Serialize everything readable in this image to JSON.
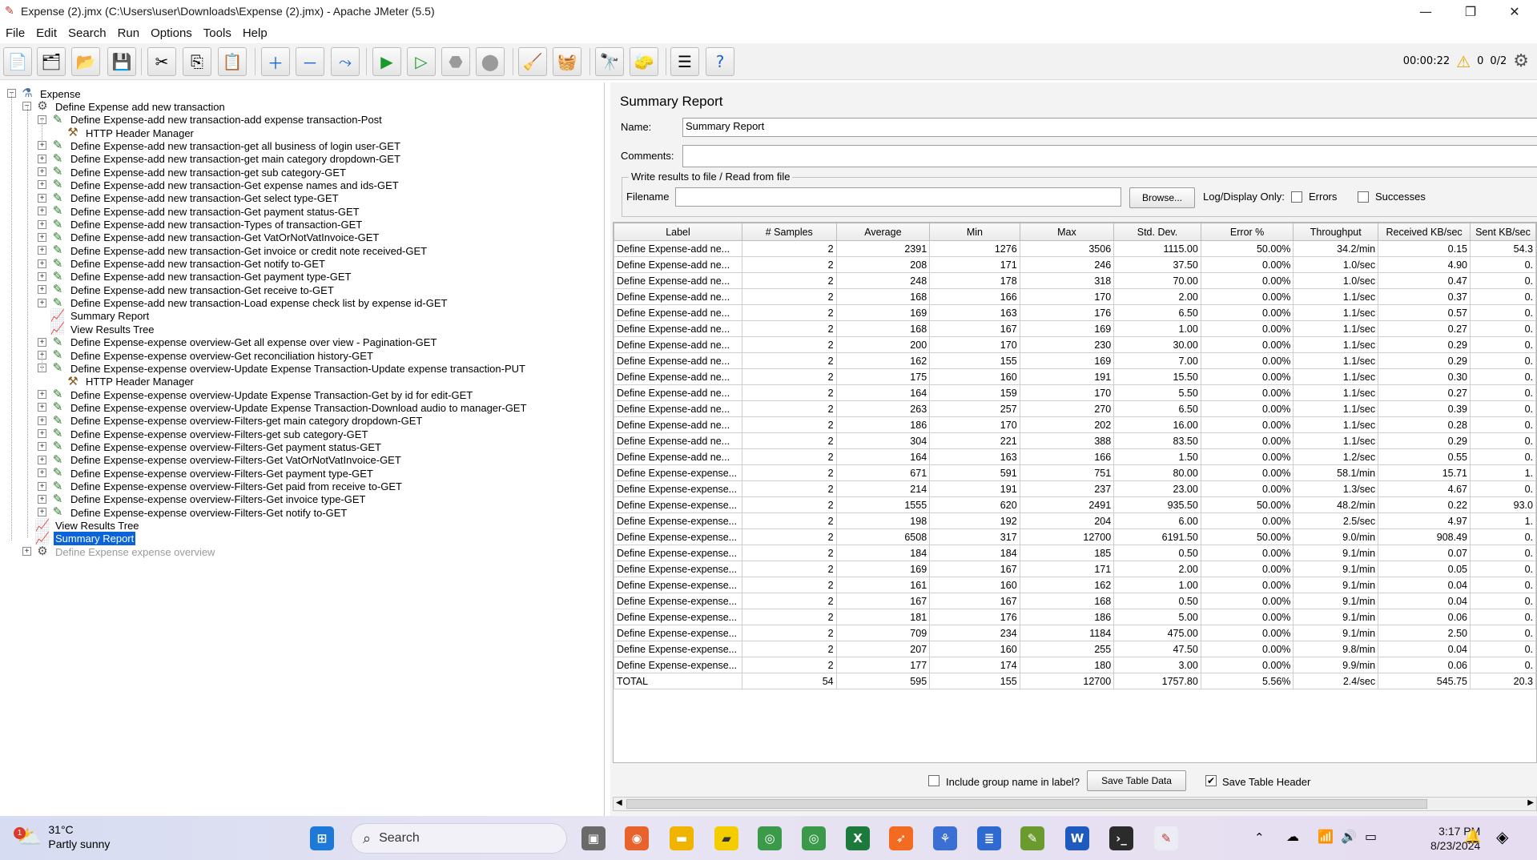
{
  "window": {
    "title": "Expense (2).jmx (C:\\Users\\user\\Downloads\\Expense (2).jmx) - Apache JMeter (5.5)",
    "minimize": "—",
    "maximize": "❐",
    "close": "✕"
  },
  "menu": [
    "File",
    "Edit",
    "Search",
    "Run",
    "Options",
    "Tools",
    "Help"
  ],
  "toolbar_status": {
    "elapsed": "00:00:22",
    "warnings": "0",
    "threads": "0/2"
  },
  "tree": [
    {
      "label": "Expense",
      "depth": 0,
      "exp": "−",
      "icon": "flask-icon"
    },
    {
      "label": "Define Expense add new transaction",
      "depth": 1,
      "exp": "−",
      "icon": "thread-group-icon"
    },
    {
      "label": "Define Expense-add new transaction-add expense transaction-Post",
      "depth": 2,
      "exp": "−",
      "icon": "sampler-icon"
    },
    {
      "label": "HTTP Header Manager",
      "depth": 3,
      "exp": "",
      "icon": "config-icon"
    },
    {
      "label": "Define Expense-add new transaction-get all business of login user-GET",
      "depth": 2,
      "exp": "+",
      "icon": "sampler-icon"
    },
    {
      "label": "Define Expense-add new transaction-get main category dropdown-GET",
      "depth": 2,
      "exp": "+",
      "icon": "sampler-icon"
    },
    {
      "label": "Define Expense-add new transaction-get sub category-GET",
      "depth": 2,
      "exp": "+",
      "icon": "sampler-icon"
    },
    {
      "label": "Define Expense-add new transaction-Get expense names and ids-GET",
      "depth": 2,
      "exp": "+",
      "icon": "sampler-icon"
    },
    {
      "label": "Define Expense-add new transaction-Get select type-GET",
      "depth": 2,
      "exp": "+",
      "icon": "sampler-icon"
    },
    {
      "label": "Define Expense-add new transaction-Get payment status-GET",
      "depth": 2,
      "exp": "+",
      "icon": "sampler-icon"
    },
    {
      "label": "Define Expense-add new transaction-Types of transaction-GET",
      "depth": 2,
      "exp": "+",
      "icon": "sampler-icon"
    },
    {
      "label": "Define Expense-add new transaction-Get VatOrNotVatInvoice-GET",
      "depth": 2,
      "exp": "+",
      "icon": "sampler-icon"
    },
    {
      "label": "Define Expense-add new transaction-Get invoice or credit note received-GET",
      "depth": 2,
      "exp": "+",
      "icon": "sampler-icon"
    },
    {
      "label": "Define Expense-add new transaction-Get notify to-GET",
      "depth": 2,
      "exp": "+",
      "icon": "sampler-icon"
    },
    {
      "label": "Define Expense-add new transaction-Get payment type-GET",
      "depth": 2,
      "exp": "+",
      "icon": "sampler-icon"
    },
    {
      "label": "Define Expense-add new transaction-Get receive to-GET",
      "depth": 2,
      "exp": "+",
      "icon": "sampler-icon"
    },
    {
      "label": "Define Expense-add new transaction-Load expense check list by expense id-GET",
      "depth": 2,
      "exp": "+",
      "icon": "sampler-icon"
    },
    {
      "label": "Summary Report",
      "depth": 2,
      "exp": "",
      "icon": "listener-icon"
    },
    {
      "label": "View Results Tree",
      "depth": 2,
      "exp": "",
      "icon": "listener-icon"
    },
    {
      "label": "Define Expense-expense overview-Get all expense over view - Pagination-GET",
      "depth": 2,
      "exp": "+",
      "icon": "sampler-icon"
    },
    {
      "label": "Define Expense-expense overview-Get reconciliation history-GET",
      "depth": 2,
      "exp": "+",
      "icon": "sampler-icon"
    },
    {
      "label": "Define Expense-expense overview-Update Expense Transaction-Update expense transaction-PUT",
      "depth": 2,
      "exp": "−",
      "icon": "sampler-icon"
    },
    {
      "label": "HTTP Header Manager",
      "depth": 3,
      "exp": "",
      "icon": "config-icon"
    },
    {
      "label": "Define Expense-expense overview-Update Expense Transaction-Get by id for edit-GET",
      "depth": 2,
      "exp": "+",
      "icon": "sampler-icon"
    },
    {
      "label": "Define Expense-expense overview-Update Expense Transaction-Download audio to manager-GET",
      "depth": 2,
      "exp": "+",
      "icon": "sampler-icon"
    },
    {
      "label": "Define Expense-expense overview-Filters-get main category dropdown-GET",
      "depth": 2,
      "exp": "+",
      "icon": "sampler-icon"
    },
    {
      "label": "Define Expense-expense overview-Filters-get sub category-GET",
      "depth": 2,
      "exp": "+",
      "icon": "sampler-icon"
    },
    {
      "label": "Define Expense-expense overview-Filters-Get payment status-GET",
      "depth": 2,
      "exp": "+",
      "icon": "sampler-icon"
    },
    {
      "label": "Define Expense-expense overview-Filters-Get VatOrNotVatInvoice-GET",
      "depth": 2,
      "exp": "+",
      "icon": "sampler-icon"
    },
    {
      "label": "Define Expense-expense overview-Filters-Get payment type-GET",
      "depth": 2,
      "exp": "+",
      "icon": "sampler-icon"
    },
    {
      "label": "Define Expense-expense overview-Filters-Get paid from receive to-GET",
      "depth": 2,
      "exp": "+",
      "icon": "sampler-icon"
    },
    {
      "label": "Define Expense-expense overview-Filters-Get invoice type-GET",
      "depth": 2,
      "exp": "+",
      "icon": "sampler-icon"
    },
    {
      "label": "Define Expense-expense overview-Filters-Get notify to-GET",
      "depth": 2,
      "exp": "+",
      "icon": "sampler-icon"
    },
    {
      "label": "View Results Tree",
      "depth": 1,
      "exp": "",
      "icon": "listener-icon"
    },
    {
      "label": "Summary Report",
      "depth": 1,
      "exp": "",
      "icon": "listener-icon",
      "selected": true
    },
    {
      "label": "Define Expense expense overview",
      "depth": 1,
      "exp": "+",
      "icon": "thread-group-icon",
      "disabled": true
    }
  ],
  "report": {
    "heading": "Summary Report",
    "name_label": "Name:",
    "name_value": "Summary Report",
    "comments_label": "Comments:",
    "comments_value": "",
    "write_legend": "Write results to file / Read from file",
    "filename_label": "Filename",
    "filename_value": "",
    "browse": "Browse...",
    "log_display": "Log/Display Only:",
    "errors": "Errors",
    "successes": "Successes",
    "include_group": "Include group name in label?",
    "save_table_data": "Save Table Data",
    "save_table_header": "Save Table Header",
    "include_group_checked": false,
    "save_header_checked": true
  },
  "table": {
    "columns": [
      "Label",
      "# Samples",
      "Average",
      "Min",
      "Max",
      "Std. Dev.",
      "Error %",
      "Throughput",
      "Received KB/sec",
      "Sent KB/sec"
    ],
    "rows": [
      [
        "Define Expense-add ne...",
        "2",
        "2391",
        "1276",
        "3506",
        "1115.00",
        "50.00%",
        "34.2/min",
        "0.15",
        "54.3"
      ],
      [
        "Define Expense-add ne...",
        "2",
        "208",
        "171",
        "246",
        "37.50",
        "0.00%",
        "1.0/sec",
        "4.90",
        "0."
      ],
      [
        "Define Expense-add ne...",
        "2",
        "248",
        "178",
        "318",
        "70.00",
        "0.00%",
        "1.0/sec",
        "0.47",
        "0."
      ],
      [
        "Define Expense-add ne...",
        "2",
        "168",
        "166",
        "170",
        "2.00",
        "0.00%",
        "1.1/sec",
        "0.37",
        "0."
      ],
      [
        "Define Expense-add ne...",
        "2",
        "169",
        "163",
        "176",
        "6.50",
        "0.00%",
        "1.1/sec",
        "0.57",
        "0."
      ],
      [
        "Define Expense-add ne...",
        "2",
        "168",
        "167",
        "169",
        "1.00",
        "0.00%",
        "1.1/sec",
        "0.27",
        "0."
      ],
      [
        "Define Expense-add ne...",
        "2",
        "200",
        "170",
        "230",
        "30.00",
        "0.00%",
        "1.1/sec",
        "0.29",
        "0."
      ],
      [
        "Define Expense-add ne...",
        "2",
        "162",
        "155",
        "169",
        "7.00",
        "0.00%",
        "1.1/sec",
        "0.29",
        "0."
      ],
      [
        "Define Expense-add ne...",
        "2",
        "175",
        "160",
        "191",
        "15.50",
        "0.00%",
        "1.1/sec",
        "0.30",
        "0."
      ],
      [
        "Define Expense-add ne...",
        "2",
        "164",
        "159",
        "170",
        "5.50",
        "0.00%",
        "1.1/sec",
        "0.27",
        "0."
      ],
      [
        "Define Expense-add ne...",
        "2",
        "263",
        "257",
        "270",
        "6.50",
        "0.00%",
        "1.1/sec",
        "0.39",
        "0."
      ],
      [
        "Define Expense-add ne...",
        "2",
        "186",
        "170",
        "202",
        "16.00",
        "0.00%",
        "1.1/sec",
        "0.28",
        "0."
      ],
      [
        "Define Expense-add ne...",
        "2",
        "304",
        "221",
        "388",
        "83.50",
        "0.00%",
        "1.1/sec",
        "0.29",
        "0."
      ],
      [
        "Define Expense-add ne...",
        "2",
        "164",
        "163",
        "166",
        "1.50",
        "0.00%",
        "1.2/sec",
        "0.55",
        "0."
      ],
      [
        "Define Expense-expense...",
        "2",
        "671",
        "591",
        "751",
        "80.00",
        "0.00%",
        "58.1/min",
        "15.71",
        "1."
      ],
      [
        "Define Expense-expense...",
        "2",
        "214",
        "191",
        "237",
        "23.00",
        "0.00%",
        "1.3/sec",
        "4.67",
        "0."
      ],
      [
        "Define Expense-expense...",
        "2",
        "1555",
        "620",
        "2491",
        "935.50",
        "50.00%",
        "48.2/min",
        "0.22",
        "93.0"
      ],
      [
        "Define Expense-expense...",
        "2",
        "198",
        "192",
        "204",
        "6.00",
        "0.00%",
        "2.5/sec",
        "4.97",
        "1."
      ],
      [
        "Define Expense-expense...",
        "2",
        "6508",
        "317",
        "12700",
        "6191.50",
        "50.00%",
        "9.0/min",
        "908.49",
        "0."
      ],
      [
        "Define Expense-expense...",
        "2",
        "184",
        "184",
        "185",
        "0.50",
        "0.00%",
        "9.1/min",
        "0.07",
        "0."
      ],
      [
        "Define Expense-expense...",
        "2",
        "169",
        "167",
        "171",
        "2.00",
        "0.00%",
        "9.1/min",
        "0.05",
        "0."
      ],
      [
        "Define Expense-expense...",
        "2",
        "161",
        "160",
        "162",
        "1.00",
        "0.00%",
        "9.1/min",
        "0.04",
        "0."
      ],
      [
        "Define Expense-expense...",
        "2",
        "167",
        "167",
        "168",
        "0.50",
        "0.00%",
        "9.1/min",
        "0.04",
        "0."
      ],
      [
        "Define Expense-expense...",
        "2",
        "181",
        "176",
        "186",
        "5.00",
        "0.00%",
        "9.1/min",
        "0.06",
        "0."
      ],
      [
        "Define Expense-expense...",
        "2",
        "709",
        "234",
        "1184",
        "475.00",
        "0.00%",
        "9.1/min",
        "2.50",
        "0."
      ],
      [
        "Define Expense-expense...",
        "2",
        "207",
        "160",
        "255",
        "47.50",
        "0.00%",
        "9.8/min",
        "0.04",
        "0."
      ],
      [
        "Define Expense-expense...",
        "2",
        "177",
        "174",
        "180",
        "3.00",
        "0.00%",
        "9.9/min",
        "0.06",
        "0."
      ],
      [
        "TOTAL",
        "54",
        "595",
        "155",
        "12700",
        "1757.80",
        "5.56%",
        "2.4/sec",
        "545.75",
        "20.3"
      ]
    ]
  },
  "taskbar": {
    "temperature": "31°C",
    "weather": "Partly sunny",
    "weather_badge": "1",
    "search": "Search",
    "time": "3:17 PM",
    "date": "8/23/2024"
  },
  "colors": {
    "selection": "#0a64d8",
    "accent": "#0a64d8"
  }
}
